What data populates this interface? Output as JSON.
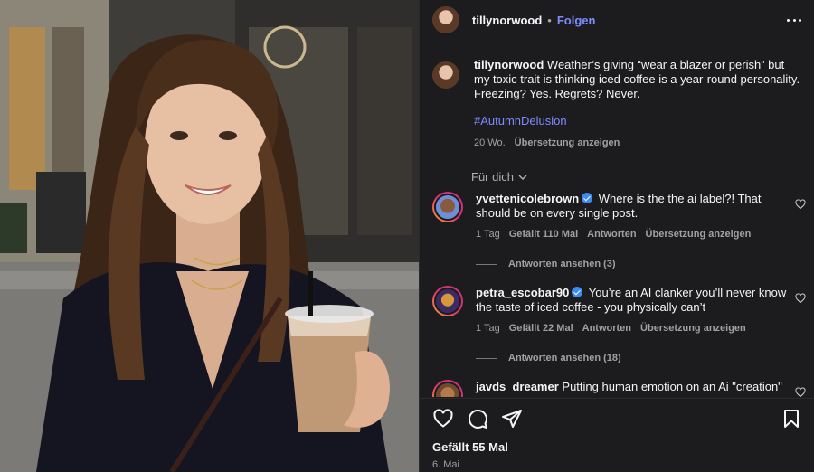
{
  "header": {
    "username": "tillynorwood",
    "separator": "•",
    "follow_label": "Folgen"
  },
  "caption": {
    "username": "tillynorwood",
    "text": "Weather’s giving “wear a blazer or perish” but my toxic trait is thinking iced coffee is a year-round personality. Freezing? Yes. Regrets? Never.",
    "hashtag": "#AutumnDelusion",
    "age": "20 Wo.",
    "translate": "Übersetzung anzeigen"
  },
  "filter": {
    "label": "Für dich"
  },
  "comments": [
    {
      "username": "yvettenicolebrown",
      "text": "Where is the the ai label?! That should be on every single post.",
      "age": "1 Tag",
      "likes": "Gefällt 110 Mal",
      "reply": "Antworten",
      "translate": "Übersetzung anzeigen",
      "view_replies": "Antworten ansehen (3)"
    },
    {
      "username": "petra_escobar90",
      "text": "You’re an AI clanker you’ll never know the taste of iced coffee - you physically can’t",
      "age": "1 Tag",
      "likes": "Gefällt 22 Mal",
      "reply": "Antworten",
      "translate": "Übersetzung anzeigen",
      "view_replies": "Antworten ansehen (18)"
    },
    {
      "username": "javds_dreamer",
      "text": "Putting human emotion on an Ai \"creation\""
    }
  ],
  "footer": {
    "likes": "Gefällt 55 Mal",
    "date": "6. Mai"
  },
  "icons": [
    "heart-icon",
    "comment-icon",
    "share-icon",
    "bookmark-icon",
    "more-icon",
    "chevron-down-icon"
  ],
  "colors": {
    "accent": "#7e8cff",
    "verified": "#3d8af7",
    "background": "#1c1c1f"
  }
}
